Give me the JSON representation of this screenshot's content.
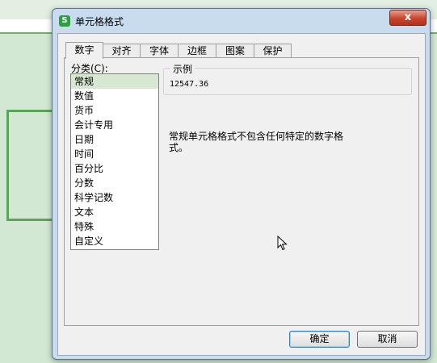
{
  "dialog": {
    "title": "单元格格式",
    "close_label": "x"
  },
  "tabs": [
    {
      "label": "数字",
      "active": true
    },
    {
      "label": "对齐",
      "active": false
    },
    {
      "label": "字体",
      "active": false
    },
    {
      "label": "边框",
      "active": false
    },
    {
      "label": "图案",
      "active": false
    },
    {
      "label": "保护",
      "active": false
    }
  ],
  "category": {
    "label": "分类(C):",
    "items": [
      "常规",
      "数值",
      "货币",
      "会计专用",
      "日期",
      "时间",
      "百分比",
      "分数",
      "科学记数",
      "文本",
      "特殊",
      "自定义"
    ],
    "selected": "常规"
  },
  "sample": {
    "title": "示例",
    "value": "12547.36"
  },
  "description": "常规单元格格式不包含任何特定的数字格式。",
  "buttons": {
    "ok": "确定",
    "cancel": "取消"
  },
  "colors": {
    "selected_item": "#d6e8d0",
    "close_button": "#c8442c",
    "app_icon": "#2e9e45"
  }
}
